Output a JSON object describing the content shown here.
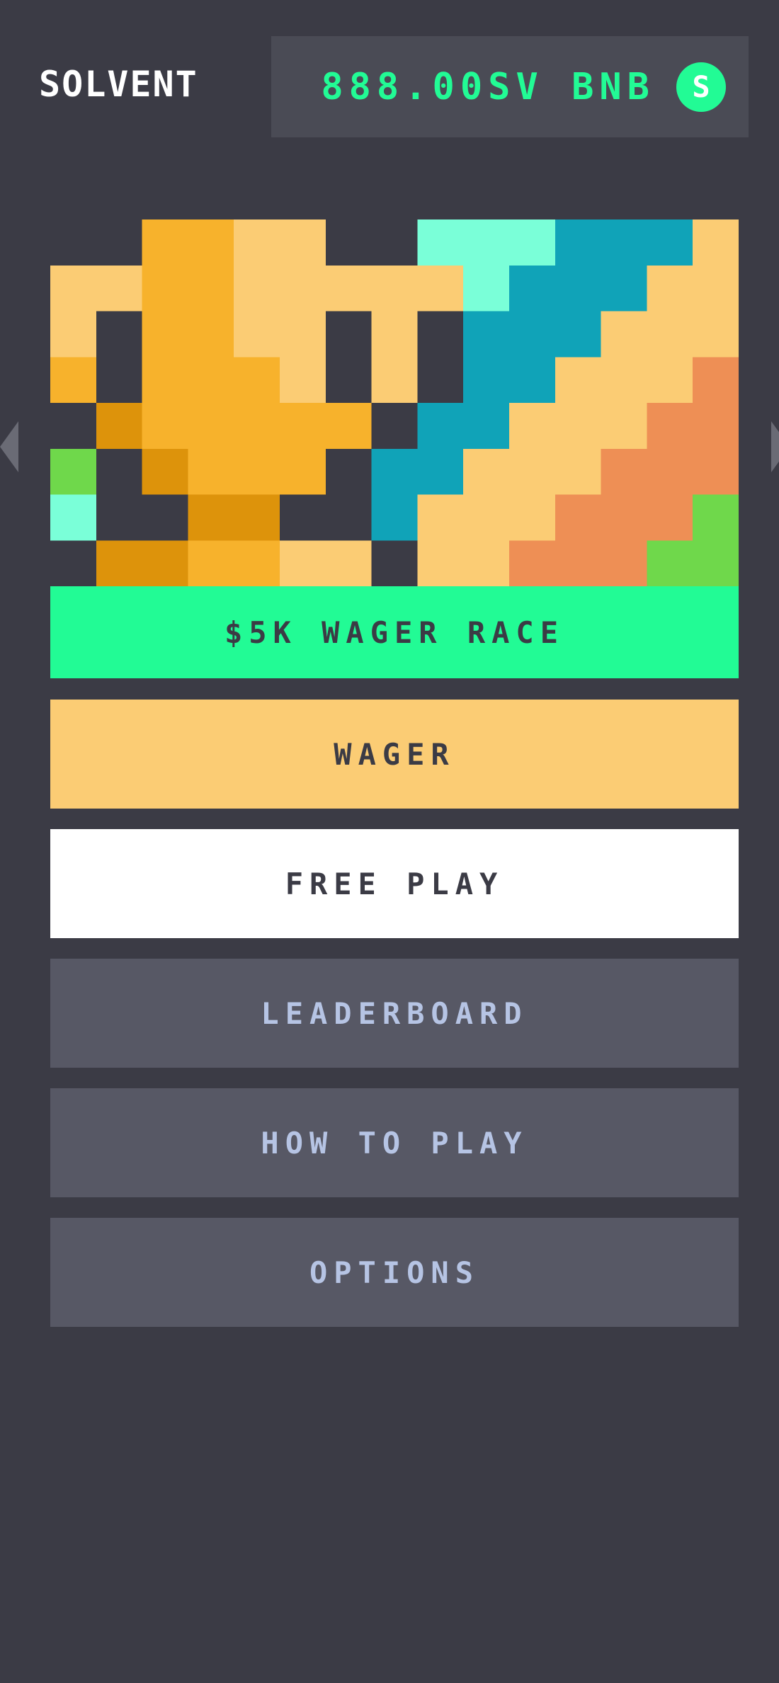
{
  "header": {
    "brand": "SOLVENT",
    "wallet": {
      "balance": "888.00SV BNB",
      "coin_symbol": "S"
    }
  },
  "carousel": {
    "prev_icon": "triangle-left-icon",
    "next_icon": "triangle-right-icon"
  },
  "banner": {
    "art_icon": "trophy-pixel-art",
    "title": "$5K WAGER RACE"
  },
  "menu": {
    "wager": "WAGER",
    "free_play": "FREE PLAY",
    "leaderboard": "LEADERBOARD",
    "how_to_play": "HOW TO PLAY",
    "options": "OPTIONS"
  },
  "colors": {
    "background": "#3b3b45",
    "accent_green": "#22fb95",
    "wager_yellow": "#fbcc74",
    "dark_button": "#575865",
    "dark_button_text": "#b6c4e4",
    "trophy_gold": "#f7b22c",
    "trophy_light": "#fbcc74",
    "trophy_dark": "#dd930b",
    "teal": "#10a3b8",
    "mint": "#7affd8",
    "orange": "#ee8f55",
    "lime": "#6fd84b"
  }
}
